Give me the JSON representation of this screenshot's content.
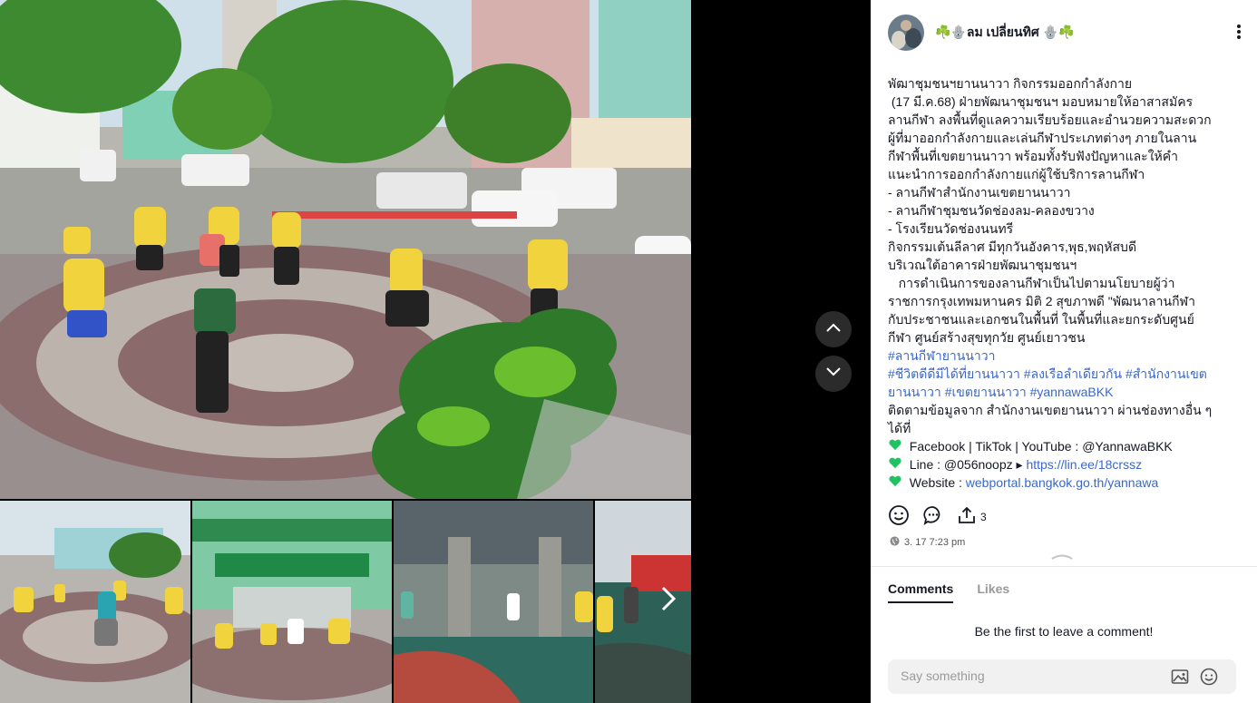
{
  "post": {
    "author": "☘️🪬ลม เปลี่ยนทิศ 🪬☘️",
    "timestamp": "3. 17 7:23 pm",
    "share_count": "3",
    "caption": {
      "line1": "พัฒาชุมชนฯยานนาวา กิจกรรมออกกำลังกาย",
      "line2": "(17 มี.ค.68) ฝ่ายพัฒนาชุมชนฯ มอบหมายให้อาสาสมัครลานกีฬา ลงพื้นที่ดูแลความเรียบร้อยและอำนวยความสะดวกผู้ที่มาออกกำลังกายและเล่นกีฬาประเภทต่างๆ ภายในลานกีฬาพื้นที่เขตยานนาวา พร้อมทั้งรับฟังปัญหาและให้คำแนะนำการออกกำลังกายแก่ผู้ใช้บริการลานกีฬา",
      "bullet1": "- ลานกีฬาสำนักงานเขตยานนาวา",
      "bullet2": "- ลานกีฬาชุมชนวัดช่องลม-คลองขวาง",
      "bullet3": "- โรงเรียนวัดช่องนนทรี",
      "line3": "กิจกรรมเต้นลีลาศ มีทุกวันอังคาร,พุธ,พฤหัสบดี",
      "line4": "บริเวณใต้อาคารฝ่ายพัฒนาชุมชนฯ",
      "line5": "การดำเนินการของลานกีฬาเป็นไปตามนโยบายผู้ว่าราชการกรุงเทพมหานคร มิติ 2 สุขภาพดี \"พัฒนาลานกีฬา กับประชาชนและเอกชนในพื้นที่ ในพื้นที่และยกระดับศูนย์กีฬา ศูนย์สร้างสุขทุกวัย ศูนย์เยาวชน",
      "hashtag1": "#ลานกีฬายานนาวา",
      "hashtag2": "#ชีวิตดีดีมีได้ที่ยานนาวา",
      "hashtag3": "#ลงเรือลำเดียวกัน",
      "hashtag4": "#สำนักงานเขตยานนาวา",
      "hashtag5": "#เขตยานนาวา",
      "hashtag6": "#yannawaBKK",
      "line6": "ติดตามข้อมูลจาก สำนักงานเขตยานนาวา ผ่านช่องทางอื่น ๆ ได้ที่",
      "contact1": "Facebook | TikTok | YouTube : @YannawaBKK",
      "contact2_prefix": "Line : @056noopz",
      "contact2_link": "https://lin.ee/18crssz",
      "contact3_prefix": "Website : ",
      "contact3_link": "webportal.bangkok.go.th/yannawa"
    }
  },
  "tabs": {
    "comments": "Comments",
    "likes": "Likes"
  },
  "empty_state": "Be the first to leave a comment!",
  "input": {
    "placeholder": "Say something"
  },
  "colors": {
    "hashtag": "#3b68c6",
    "heart": "#20c261",
    "panel_bg": "#ffffff",
    "viewer_bg": "#000000"
  },
  "icons": [
    "chevron-up-icon",
    "chevron-down-icon",
    "chevron-right-icon",
    "more-icon",
    "emoji-icon",
    "comment-icon",
    "share-icon",
    "globe-icon",
    "image-icon",
    "green-heart-icon"
  ]
}
